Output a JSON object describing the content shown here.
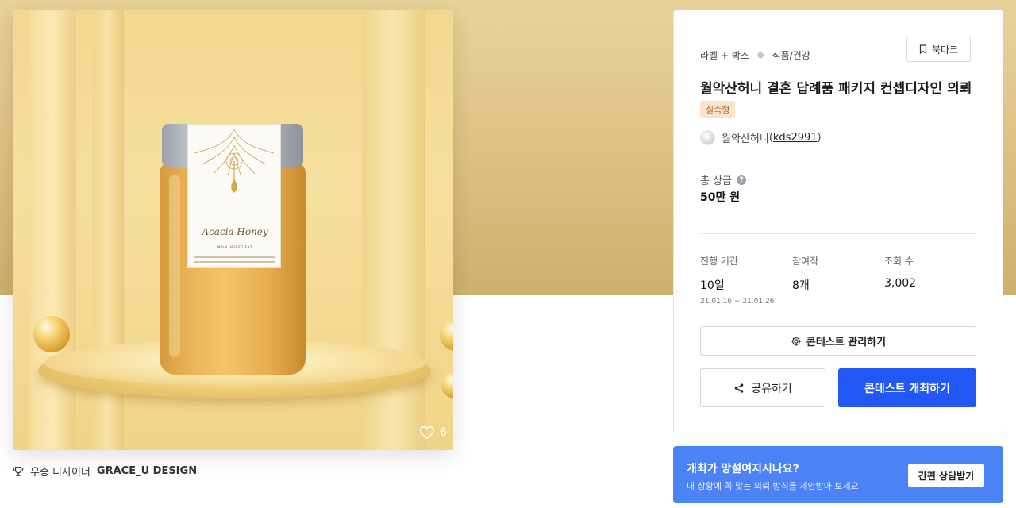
{
  "product": {
    "image_alt": "Acacia Honey jar",
    "label_title": "Acacia Honey",
    "label_sub": "MAIN INGREDIENT",
    "likes_count": "6"
  },
  "winner": {
    "prefix": "우승 디자이너",
    "name": "GRACE_U DESIGN"
  },
  "info": {
    "breadcrumbs": [
      "라벨 + 박스",
      "식품/건강"
    ],
    "bookmark_label": "북마크",
    "title": "월악산허니 결혼 답례품 패키지 컨셉디자인 의뢰",
    "badge": "실속형",
    "host_name": "월악산허니",
    "host_handle_open": "(",
    "host_handle": "kds2991",
    "host_handle_close": ")",
    "prize_label": "총 상금",
    "prize_value": "50만 원",
    "stats": [
      {
        "label": "진행 기간",
        "value": "10일",
        "range": "21.01.16 ~ 21.01.26"
      },
      {
        "label": "참여작",
        "value": "8개"
      },
      {
        "label": "조회 수",
        "value": "3,002"
      }
    ],
    "manage_button": "콘테스트 관리하기",
    "share_button": "공유하기",
    "host_button": "콘테스트 개최하기"
  },
  "help": {
    "title": "개최가 망설여지시나요?",
    "description": "내 상황에 꼭 맞는 의뢰 방식을 제안받아 보세요",
    "button": "간편 상담받기"
  },
  "colors": {
    "primary": "#2157f2",
    "banner": "#4b82f6",
    "badge_bg": "#f8e3cf",
    "badge_text": "#b9692a"
  }
}
